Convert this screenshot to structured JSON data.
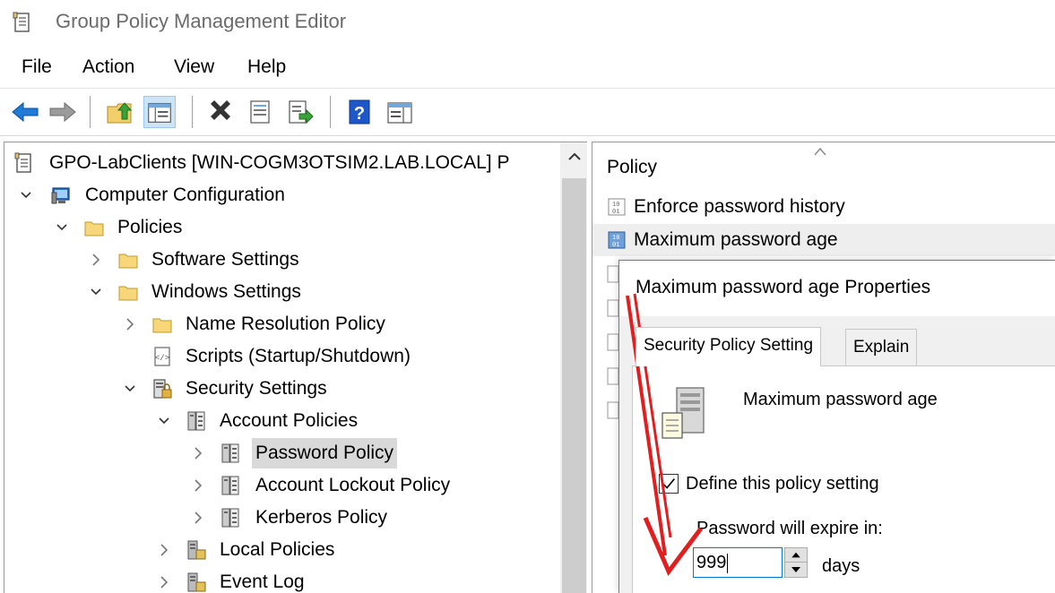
{
  "window": {
    "title": "Group Policy Management Editor"
  },
  "menu": {
    "items": [
      "File",
      "Action",
      "View",
      "Help"
    ]
  },
  "toolbar": {
    "buttons": [
      "back-icon",
      "forward-icon",
      "up-folder-icon",
      "show-hide-tree-icon",
      "delete-icon",
      "properties-icon",
      "export-list-icon",
      "help-icon",
      "show-action-pane-icon"
    ]
  },
  "tree": {
    "root": "GPO-LabClients [WIN-COGM3OTSIM2.LAB.LOCAL] P",
    "items": [
      {
        "label": "Computer Configuration"
      },
      {
        "label": "Policies"
      },
      {
        "label": "Software Settings"
      },
      {
        "label": "Windows Settings"
      },
      {
        "label": "Name Resolution Policy"
      },
      {
        "label": "Scripts (Startup/Shutdown)"
      },
      {
        "label": "Security Settings"
      },
      {
        "label": "Account Policies"
      },
      {
        "label": "Password Policy"
      },
      {
        "label": "Account Lockout Policy"
      },
      {
        "label": "Kerberos Policy"
      },
      {
        "label": "Local Policies"
      },
      {
        "label": "Event Log"
      }
    ]
  },
  "list": {
    "column_header": "Policy",
    "rows": [
      {
        "label": "Enforce password history"
      },
      {
        "label": "Maximum password age"
      }
    ]
  },
  "dialog": {
    "title": "Maximum password age Properties",
    "tabs": [
      "Security Policy Setting",
      "Explain"
    ],
    "setting_name": "Maximum password age",
    "define_checkbox_label": "Define this policy setting",
    "define_checked": true,
    "expire_label": "Password will expire in:",
    "expire_value": "999",
    "unit_label": "days"
  },
  "colors": {
    "selection": "#d9d9d9",
    "focus_border": "#0078d7",
    "annotation": "#e02020"
  }
}
